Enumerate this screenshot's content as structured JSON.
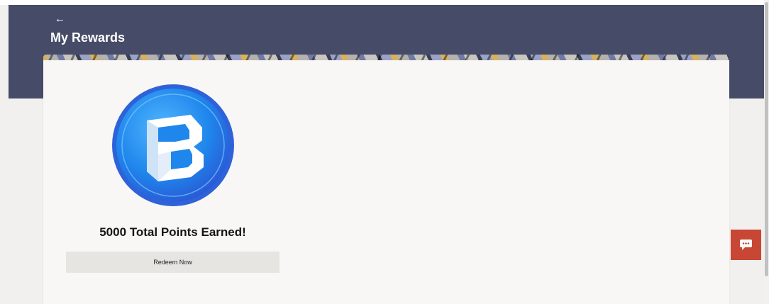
{
  "header": {
    "back_icon": "←",
    "title": "My Rewards"
  },
  "rewards": {
    "logo_icon": "rewards-logo-icon",
    "points_message": "5000 Total Points Earned!",
    "redeem_label": "Redeem Now"
  },
  "chat": {
    "icon": "chat-icon"
  },
  "colors": {
    "header_bg": "#464c68",
    "card_bg": "#f9f7f5",
    "chat_bg": "#c74634",
    "button_bg": "#e7e5e2",
    "logo_blue": "#1f7be8"
  }
}
